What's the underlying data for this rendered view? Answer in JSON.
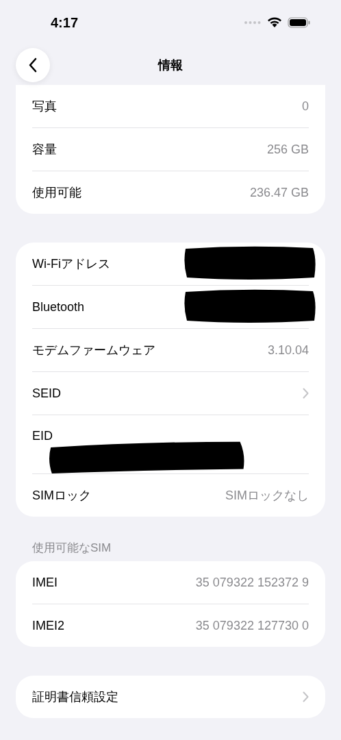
{
  "status_bar": {
    "time": "4:17"
  },
  "nav": {
    "title": "情報"
  },
  "groups": [
    {
      "rows": [
        {
          "kind": "value",
          "label": "写真",
          "value": "0"
        },
        {
          "kind": "value",
          "label": "容量",
          "value": "256 GB"
        },
        {
          "kind": "value",
          "label": "使用可能",
          "value": "236.47 GB"
        }
      ]
    },
    {
      "rows": [
        {
          "kind": "redacted",
          "label": "Wi-Fiアドレス"
        },
        {
          "kind": "redacted",
          "label": "Bluetooth"
        },
        {
          "kind": "value",
          "label": "モデムファームウェア",
          "value": "3.10.04"
        },
        {
          "kind": "link",
          "label": "SEID"
        },
        {
          "kind": "redacted_below",
          "label": "EID"
        },
        {
          "kind": "value",
          "label": "SIMロック",
          "value": "SIMロックなし"
        }
      ]
    },
    {
      "header": "使用可能なSIM",
      "rows": [
        {
          "kind": "value",
          "label": "IMEI",
          "value": "35 079322 152372 9"
        },
        {
          "kind": "value",
          "label": "IMEI2",
          "value": "35 079322 127730 0"
        }
      ]
    },
    {
      "rows": [
        {
          "kind": "link",
          "label": "証明書信頼設定"
        }
      ]
    }
  ]
}
